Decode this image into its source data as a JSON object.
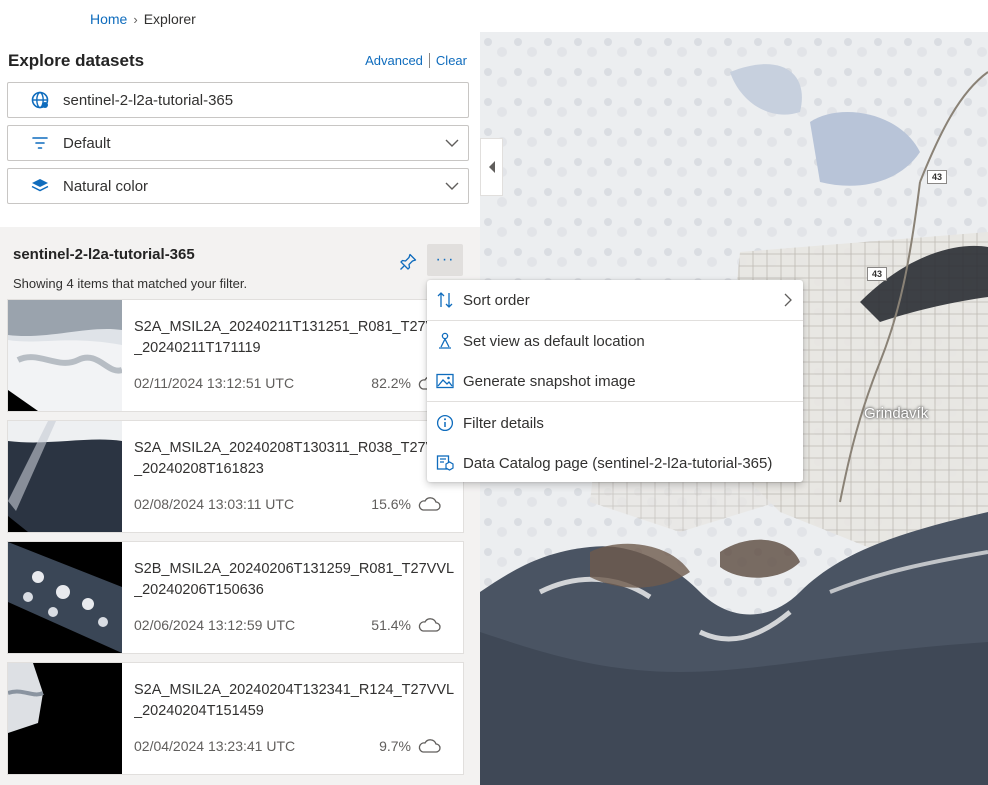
{
  "breadcrumb": {
    "home": "Home",
    "separator": "›",
    "current": "Explorer"
  },
  "panel": {
    "title": "Explore datasets",
    "advanced_link": "Advanced",
    "clear_link": "Clear",
    "dataset_field": {
      "value": "sentinel-2-l2a-tutorial-365",
      "icon": "globe-icon"
    },
    "filter_dropdown": {
      "value": "Default",
      "icon": "filter-icon"
    },
    "render_dropdown": {
      "value": "Natural color",
      "icon": "layers-icon"
    }
  },
  "results": {
    "collection_title": "sentinel-2-l2a-tutorial-365",
    "more_label": "···",
    "showing_text": "Showing 4 items that matched your filter.",
    "items": [
      {
        "id": "S2A_MSIL2A_20240211T131251_R081_T27VVL_20240211T171119",
        "date": "02/11/2024 13:12:51 UTC",
        "cloud": "82.2%"
      },
      {
        "id": "S2A_MSIL2A_20240208T130311_R038_T27VVL_20240208T161823",
        "date": "02/08/2024 13:03:11 UTC",
        "cloud": "15.6%"
      },
      {
        "id": "S2B_MSIL2A_20240206T131259_R081_T27VVL_20240206T150636",
        "date": "02/06/2024 13:12:59 UTC",
        "cloud": "51.4%"
      },
      {
        "id": "S2A_MSIL2A_20240204T132341_R124_T27VVL_20240204T151459",
        "date": "02/04/2024 13:23:41 UTC",
        "cloud": "9.7%"
      }
    ]
  },
  "menu": {
    "items": [
      {
        "label": "Sort order",
        "icon": "sort-icon",
        "has_submenu": true
      },
      {
        "label": "Set view as default location",
        "icon": "location-person-icon"
      },
      {
        "label": "Generate snapshot image",
        "icon": "image-icon"
      },
      {
        "label": "Filter details",
        "icon": "info-icon"
      },
      {
        "label": "Data Catalog page (sentinel-2-l2a-tutorial-365)",
        "icon": "catalog-icon"
      }
    ]
  },
  "map": {
    "town_label": "Grindavík",
    "road_badges": [
      "43",
      "43"
    ]
  },
  "colors": {
    "accent": "#0f6cbd",
    "panel_bg": "#f3f2f1",
    "border": "#c8c6c4"
  }
}
